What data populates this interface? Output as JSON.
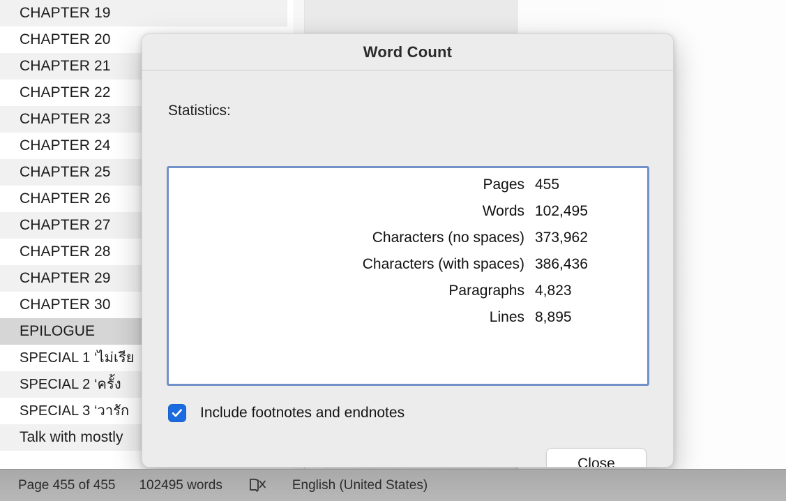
{
  "sidebar": {
    "items": [
      {
        "label": "CHAPTER 19",
        "style": "alt",
        "selected": false
      },
      {
        "label": "CHAPTER 20",
        "style": "plain",
        "selected": false
      },
      {
        "label": "CHAPTER 21",
        "style": "alt",
        "selected": false
      },
      {
        "label": "CHAPTER 22",
        "style": "plain",
        "selected": false
      },
      {
        "label": "CHAPTER 23",
        "style": "alt",
        "selected": false
      },
      {
        "label": "CHAPTER 24",
        "style": "plain",
        "selected": false
      },
      {
        "label": "CHAPTER 25",
        "style": "alt",
        "selected": false
      },
      {
        "label": "CHAPTER 26",
        "style": "plain",
        "selected": false
      },
      {
        "label": "CHAPTER 27",
        "style": "alt",
        "selected": false
      },
      {
        "label": "CHAPTER 28",
        "style": "plain",
        "selected": false
      },
      {
        "label": "CHAPTER 29",
        "style": "alt",
        "selected": false
      },
      {
        "label": "CHAPTER 30",
        "style": "plain",
        "selected": false
      },
      {
        "label": "EPILOGUE",
        "style": "sel",
        "selected": true
      },
      {
        "label": "SPECIAL 1 ‘ไม่เรีย",
        "style": "plain",
        "selected": false
      },
      {
        "label": "SPECIAL 2 ‘ครั้ง",
        "style": "alt",
        "selected": false
      },
      {
        "label": "SPECIAL 3 ‘วารัก",
        "style": "plain",
        "selected": false
      },
      {
        "label": "Talk with mostly",
        "style": "alt",
        "selected": false
      }
    ]
  },
  "dialog": {
    "title": "Word Count",
    "statistics_label": "Statistics:",
    "stats": [
      {
        "key": "Pages",
        "value": "455"
      },
      {
        "key": "Words",
        "value": "102,495"
      },
      {
        "key": "Characters (no spaces)",
        "value": "373,962"
      },
      {
        "key": "Characters (with spaces)",
        "value": "386,436"
      },
      {
        "key": "Paragraphs",
        "value": "4,823"
      },
      {
        "key": "Lines",
        "value": "8,895"
      }
    ],
    "footnotes_checkbox": {
      "label": "Include footnotes and endnotes",
      "checked": true
    },
    "close_label": "Close"
  },
  "statusbar": {
    "page": "Page 455 of 455",
    "words": "102495 words",
    "proofing_icon": "book-proofing-error-icon",
    "language": "English (United States)"
  },
  "colors": {
    "accent_checkbox": "#1c6ae0",
    "focus_ring": "#7191c8",
    "dialog_bg": "#ececec",
    "statusbar_bg": "#b4b4b4",
    "sidebar_selected": "#d6d6d6"
  }
}
